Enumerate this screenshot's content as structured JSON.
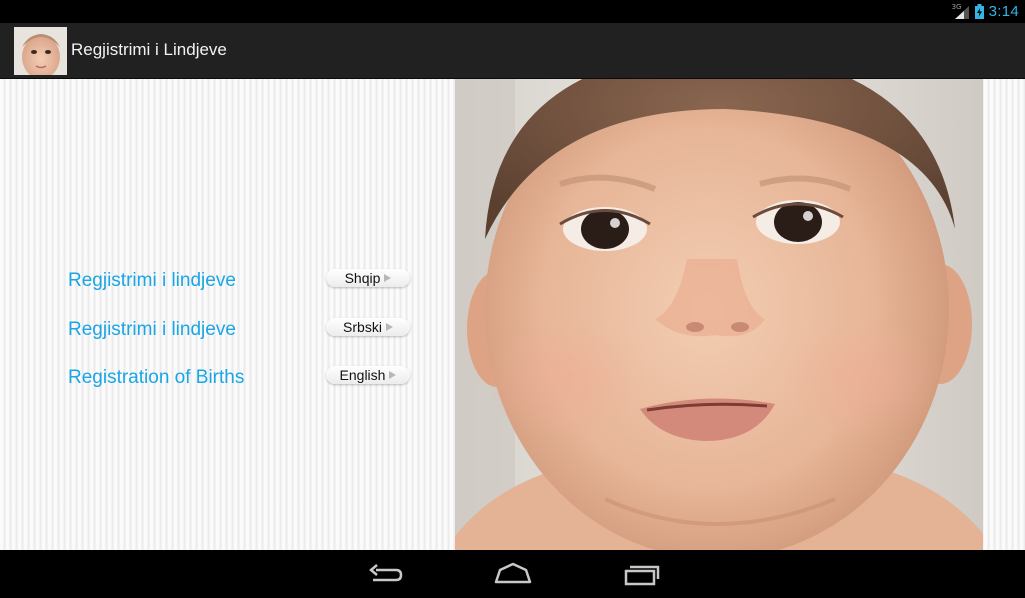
{
  "status_bar": {
    "network_label": "3G",
    "time": "3:14",
    "accent_color": "#33b5e5"
  },
  "action_bar": {
    "title": "Regjistrimi i Lindjeve",
    "app_icon": "baby-photo-icon"
  },
  "languages": [
    {
      "title": "Regjistrimi i lindjeve",
      "button_label": "Shqip"
    },
    {
      "title": "Regjistrimi i lindjeve",
      "button_label": "Srbski"
    },
    {
      "title": "Registration of Births",
      "button_label": "English"
    }
  ],
  "colors": {
    "link_blue": "#1aa6e6",
    "action_bar": "#212121"
  },
  "nav_bar": {
    "back_icon": "back-icon",
    "home_icon": "home-icon",
    "recents_icon": "recent-apps-icon"
  }
}
